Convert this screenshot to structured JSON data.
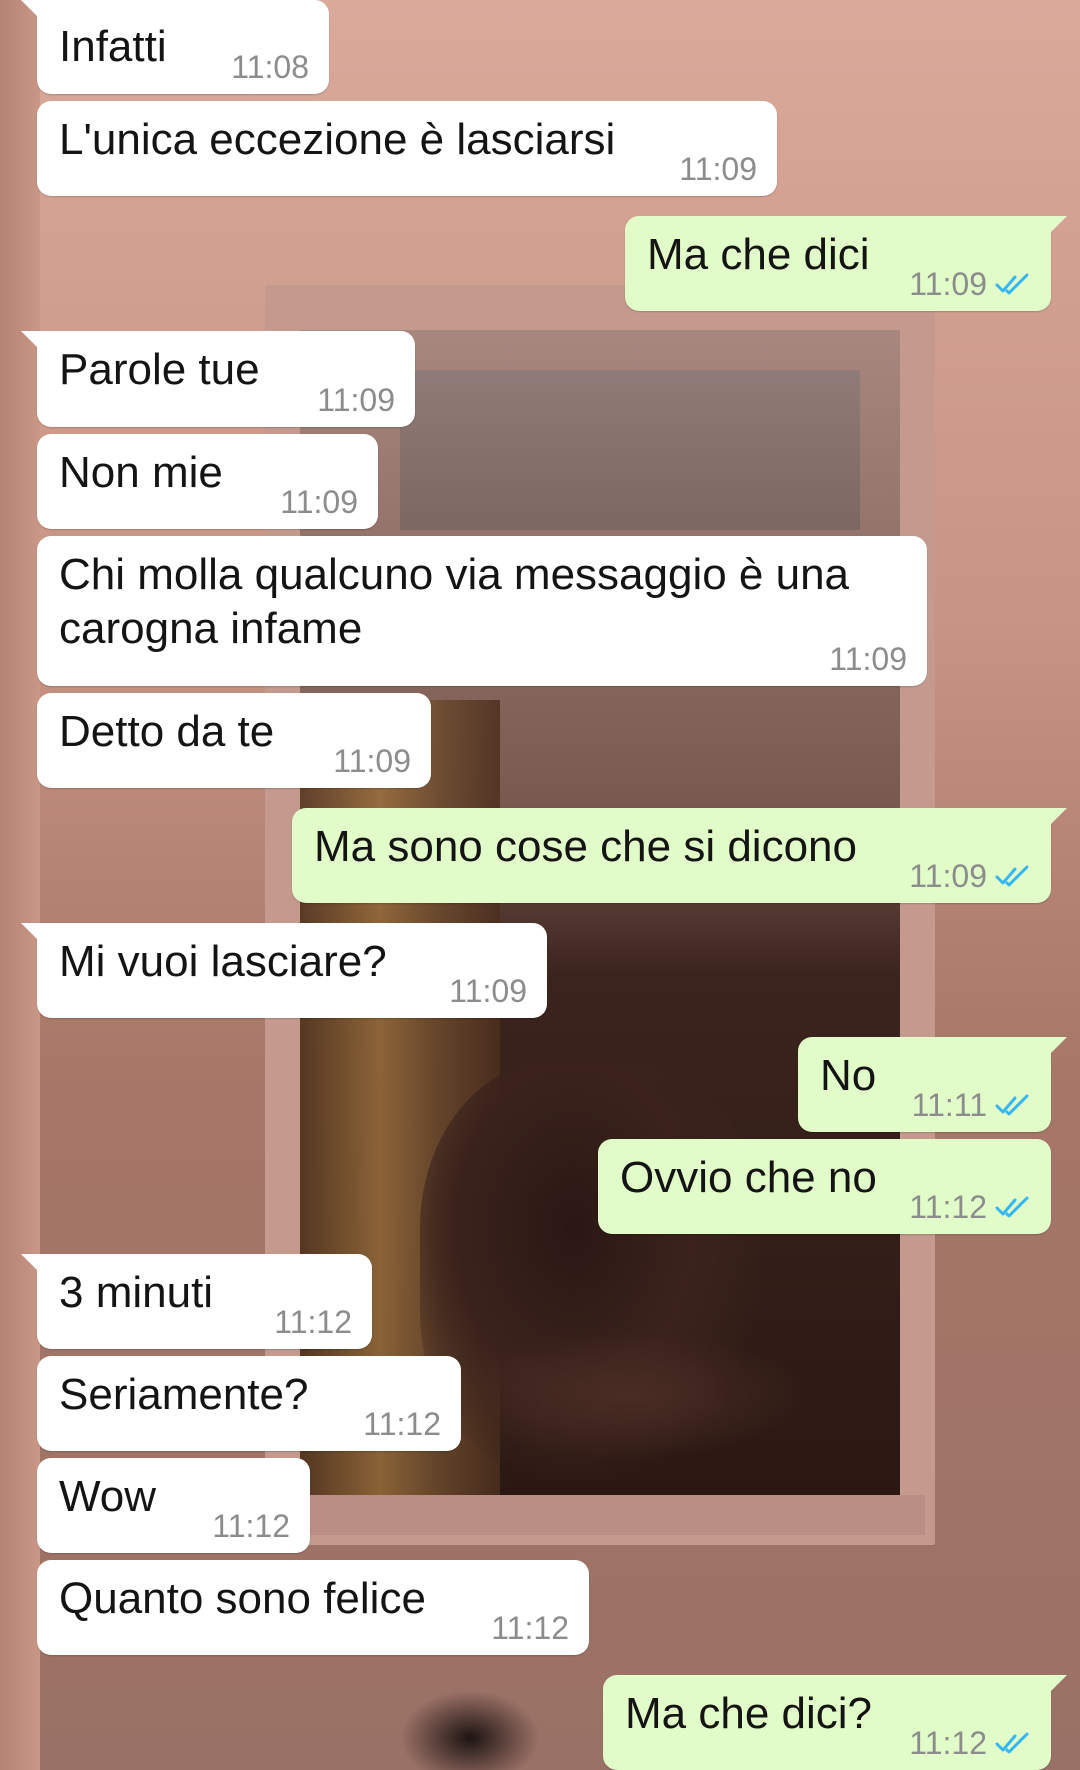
{
  "colors": {
    "incoming_bubble": "#ffffff",
    "outgoing_bubble": "#e2fcc9",
    "timestamp": "#8c8c8c",
    "read_ticks": "#34b7f1",
    "text": "#141414"
  },
  "messages": [
    {
      "direction": "in",
      "text": "Infatti",
      "time": "11:08"
    },
    {
      "direction": "in",
      "text": "L'unica eccezione è lasciarsi",
      "time": "11:09"
    },
    {
      "direction": "out",
      "text": "Ma che dici",
      "time": "11:09",
      "status": "read-double-check-icon"
    },
    {
      "direction": "in",
      "text": "Parole tue",
      "time": "11:09"
    },
    {
      "direction": "in",
      "text": "Non mie",
      "time": "11:09"
    },
    {
      "direction": "in",
      "text": "Chi molla qualcuno via messaggio è una carogna infame",
      "time": "11:09"
    },
    {
      "direction": "in",
      "text": "Detto da te",
      "time": "11:09"
    },
    {
      "direction": "out",
      "text": "Ma sono cose che si dicono",
      "time": "11:09",
      "status": "read-double-check-icon"
    },
    {
      "direction": "in",
      "text": "Mi vuoi lasciare?",
      "time": "11:09"
    },
    {
      "direction": "out",
      "text": "No",
      "time": "11:11",
      "status": "read-double-check-icon"
    },
    {
      "direction": "out",
      "text": "Ovvio che no",
      "time": "11:12",
      "status": "read-double-check-icon"
    },
    {
      "direction": "in",
      "text": "3 minuti",
      "time": "11:12"
    },
    {
      "direction": "in",
      "text": "Seriamente?",
      "time": "11:12"
    },
    {
      "direction": "in",
      "text": "Wow",
      "time": "11:12"
    },
    {
      "direction": "in",
      "text": "Quanto sono felice",
      "time": "11:12"
    },
    {
      "direction": "out",
      "text": "Ma che dici?",
      "time": "11:12",
      "status": "read-double-check-icon"
    }
  ]
}
